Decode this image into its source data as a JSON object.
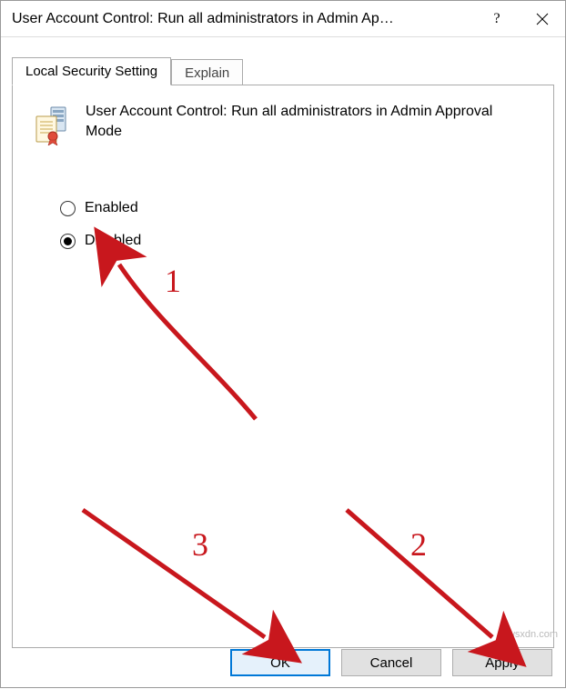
{
  "window": {
    "title": "User Account Control: Run all administrators in Admin Ap…"
  },
  "tabs": {
    "local": "Local Security Setting",
    "explain": "Explain"
  },
  "policy": {
    "title": "User Account Control: Run all administrators in Admin Approval Mode"
  },
  "options": {
    "enabled": "Enabled",
    "disabled": "Disabled",
    "selected": "disabled"
  },
  "buttons": {
    "ok": "OK",
    "cancel": "Cancel",
    "apply": "Apply"
  },
  "annotations": {
    "label1": "1",
    "label2": "2",
    "label3": "3"
  },
  "watermark": "wsxdn.com"
}
